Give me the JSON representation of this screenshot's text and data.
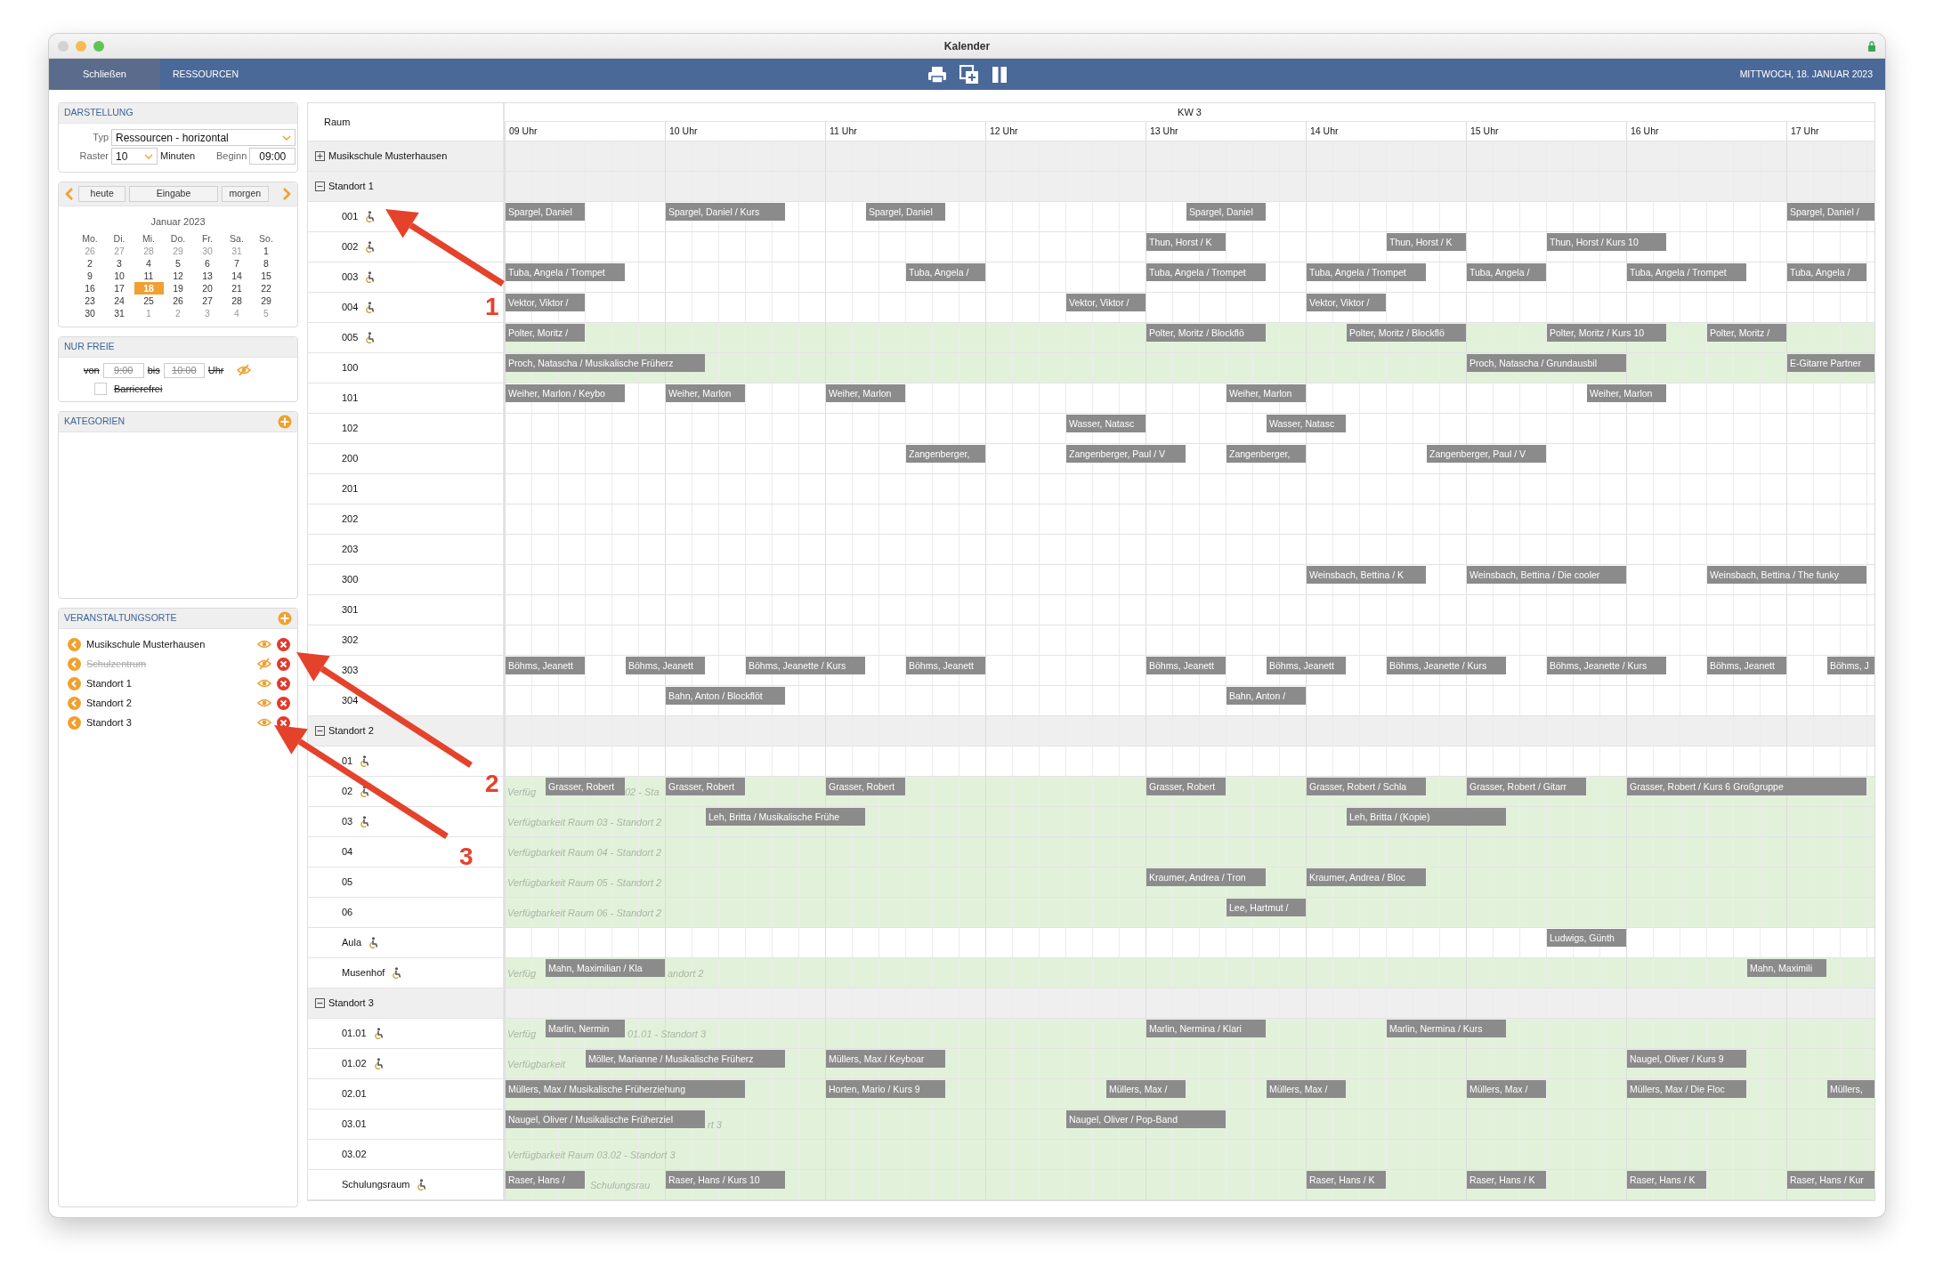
{
  "window": {
    "title": "Kalender"
  },
  "toolbar": {
    "close_button": "Schließen",
    "section": "RESSOURCEN",
    "date": "MITTWOCH, 18. JANUAR 2023"
  },
  "display": {
    "title": "DARSTELLUNG",
    "type_label": "Typ",
    "type_value": "Ressourcen - horizontal",
    "grid_label": "Raster",
    "grid_value": "10",
    "grid_unit": "Minuten",
    "start_label": "Beginn",
    "start_value": "09:00"
  },
  "date_nav": {
    "today": "heute",
    "entry": "Eingabe",
    "tomorrow": "morgen",
    "month": "Januar 2023",
    "weekdays": [
      "Mo.",
      "Di.",
      "Mi.",
      "Do.",
      "Fr.",
      "Sa.",
      "So."
    ],
    "weeks": [
      [
        {
          "day": "26",
          "other_month": true,
          "selected": false
        },
        {
          "day": "27",
          "other_month": true,
          "selected": false
        },
        {
          "day": "28",
          "other_month": true,
          "selected": false
        },
        {
          "day": "29",
          "other_month": true,
          "selected": false
        },
        {
          "day": "30",
          "other_month": true,
          "selected": false
        },
        {
          "day": "31",
          "other_month": true,
          "selected": false
        },
        {
          "day": "1",
          "other_month": false,
          "selected": false
        }
      ],
      [
        {
          "day": "2",
          "other_month": false,
          "selected": false
        },
        {
          "day": "3",
          "other_month": false,
          "selected": false
        },
        {
          "day": "4",
          "other_month": false,
          "selected": false
        },
        {
          "day": "5",
          "other_month": false,
          "selected": false
        },
        {
          "day": "6",
          "other_month": false,
          "selected": false
        },
        {
          "day": "7",
          "other_month": false,
          "selected": false
        },
        {
          "day": "8",
          "other_month": false,
          "selected": false
        }
      ],
      [
        {
          "day": "9",
          "other_month": false,
          "selected": false
        },
        {
          "day": "10",
          "other_month": false,
          "selected": false
        },
        {
          "day": "11",
          "other_month": false,
          "selected": false
        },
        {
          "day": "12",
          "other_month": false,
          "selected": false
        },
        {
          "day": "13",
          "other_month": false,
          "selected": false
        },
        {
          "day": "14",
          "other_month": false,
          "selected": false
        },
        {
          "day": "15",
          "other_month": false,
          "selected": false
        }
      ],
      [
        {
          "day": "16",
          "other_month": false,
          "selected": false
        },
        {
          "day": "17",
          "other_month": false,
          "selected": false
        },
        {
          "day": "18",
          "other_month": false,
          "selected": true
        },
        {
          "day": "19",
          "other_month": false,
          "selected": false
        },
        {
          "day": "20",
          "other_month": false,
          "selected": false
        },
        {
          "day": "21",
          "other_month": false,
          "selected": false
        },
        {
          "day": "22",
          "other_month": false,
          "selected": false
        }
      ],
      [
        {
          "day": "23",
          "other_month": false,
          "selected": false
        },
        {
          "day": "24",
          "other_month": false,
          "selected": false
        },
        {
          "day": "25",
          "other_month": false,
          "selected": false
        },
        {
          "day": "26",
          "other_month": false,
          "selected": false
        },
        {
          "day": "27",
          "other_month": false,
          "selected": false
        },
        {
          "day": "28",
          "other_month": false,
          "selected": false
        },
        {
          "day": "29",
          "other_month": false,
          "selected": false
        }
      ],
      [
        {
          "day": "30",
          "other_month": false,
          "selected": false
        },
        {
          "day": "31",
          "other_month": false,
          "selected": false
        },
        {
          "day": "1",
          "other_month": true,
          "selected": false
        },
        {
          "day": "2",
          "other_month": true,
          "selected": false
        },
        {
          "day": "3",
          "other_month": true,
          "selected": false
        },
        {
          "day": "4",
          "other_month": true,
          "selected": false
        },
        {
          "day": "5",
          "other_month": true,
          "selected": false
        }
      ]
    ]
  },
  "free_only": {
    "title": "NUR FREIE",
    "from_label": "von",
    "from_value": "9:00",
    "to_label": "bis",
    "to_value": "10:00",
    "unit": "Uhr",
    "enabled": false,
    "barrier_free": {
      "label": "Barrierefrei",
      "checked": false
    }
  },
  "categories": {
    "title": "KATEGORIEN"
  },
  "venues": {
    "title": "VERANSTALTUNGSORTE",
    "items": [
      {
        "name": "Musikschule Musterhausen",
        "visible": true
      },
      {
        "name": "Schulzentrum",
        "visible": false
      },
      {
        "name": "Standort 1",
        "visible": true
      },
      {
        "name": "Standort 2",
        "visible": true
      },
      {
        "name": "Standort 3",
        "visible": true
      }
    ]
  },
  "schedule": {
    "room_header": "Raum",
    "week": "KW 3",
    "hours": [
      "09 Uhr",
      "10 Uhr",
      "11 Uhr",
      "12 Uhr",
      "13 Uhr",
      "14 Uhr",
      "15 Uhr",
      "16 Uhr",
      "17 Uhr"
    ],
    "groups": [
      {
        "name": "Musikschule Musterhausen",
        "expanded": false
      },
      {
        "name": "Standort 1",
        "expanded": true,
        "rooms": [
          {
            "name": "001",
            "accessible": true,
            "available": false,
            "events": [
              {
                "text": "Spargel, Daniel"
              },
              {
                "text": "Spargel, Daniel / Kurs"
              },
              {
                "text": "Spargel, Daniel"
              },
              {
                "text": "Spargel, Daniel"
              },
              {
                "text": "Spargel, Daniel /"
              }
            ]
          },
          {
            "name": "002",
            "accessible": true,
            "available": false,
            "events": [
              {
                "text": "Thun, Horst / K"
              },
              {
                "text": "Thun, Horst / K"
              },
              {
                "text": "Thun, Horst / Kurs 10"
              }
            ]
          },
          {
            "name": "003",
            "accessible": true,
            "available": false,
            "events": [
              {
                "text": "Tuba, Angela / Trompet"
              },
              {
                "text": "Tuba, Angela /"
              },
              {
                "text": "Tuba, Angela / Trompet"
              },
              {
                "text": "Tuba, Angela / Trompet"
              },
              {
                "text": "Tuba, Angela /"
              },
              {
                "text": "Tuba, Angela / Trompet"
              },
              {
                "text": "Tuba, Angela /"
              }
            ]
          },
          {
            "name": "004",
            "accessible": true,
            "available": false,
            "events": [
              {
                "text": "Vektor, Viktor /"
              },
              {
                "text": "Vektor, Viktor /"
              },
              {
                "text": "Vektor, Viktor /"
              }
            ]
          },
          {
            "name": "005",
            "accessible": true,
            "available": true,
            "events": [
              {
                "text": "Polter, Moritz /"
              },
              {
                "text": "Polter, Moritz / Blockflö"
              },
              {
                "text": "Polter, Moritz / Blockflö"
              },
              {
                "text": "Polter, Moritz / Kurs 10"
              },
              {
                "text": "Polter, Moritz /"
              }
            ]
          },
          {
            "name": "100",
            "accessible": false,
            "available": true,
            "events": [
              {
                "text": "Proch, Natascha / Musikalische Früherz"
              },
              {
                "text": "Proch, Natascha / Grundausbil"
              },
              {
                "text": "E-Gitarre Partner"
              }
            ]
          },
          {
            "name": "101",
            "accessible": false,
            "available": false,
            "events": [
              {
                "text": "Weiher, Marlon / Keybo"
              },
              {
                "text": "Weiher, Marlon"
              },
              {
                "text": "Weiher, Marlon"
              },
              {
                "text": "Weiher, Marlon"
              },
              {
                "text": "Weiher, Marlon"
              }
            ]
          },
          {
            "name": "102",
            "accessible": false,
            "available": false,
            "events": [
              {
                "text": "Wasser, Natasc"
              },
              {
                "text": "Wasser, Natasc"
              }
            ]
          },
          {
            "name": "200",
            "accessible": false,
            "available": false,
            "events": [
              {
                "text": "Zangenberger,"
              },
              {
                "text": "Zangenberger, Paul / V"
              },
              {
                "text": "Zangenberger,"
              },
              {
                "text": "Zangenberger, Paul / V"
              }
            ]
          },
          {
            "name": "201",
            "accessible": false,
            "available": false
          },
          {
            "name": "202",
            "accessible": false,
            "available": false
          },
          {
            "name": "203",
            "accessible": false,
            "available": false
          },
          {
            "name": "300",
            "accessible": false,
            "available": false,
            "events": [
              {
                "text": "Weinsbach, Bettina / K"
              },
              {
                "text": "Weinsbach, Bettina / Die cooler"
              },
              {
                "text": "Weinsbach, Bettina / The funky"
              }
            ]
          },
          {
            "name": "301",
            "accessible": false,
            "available": false
          },
          {
            "name": "302",
            "accessible": false,
            "available": false
          },
          {
            "name": "303",
            "accessible": false,
            "available": false,
            "events": [
              {
                "text": "Böhms, Jeanett"
              },
              {
                "text": "Böhms, Jeanett"
              },
              {
                "text": "Böhms, Jeanette / Kurs"
              },
              {
                "text": "Böhms, Jeanett"
              },
              {
                "text": "Böhms, Jeanett"
              },
              {
                "text": "Böhms, Jeanett"
              },
              {
                "text": "Böhms, Jeanette / Kurs"
              },
              {
                "text": "Böhms, Jeanette / Kurs"
              },
              {
                "text": "Böhms, Jeanett"
              },
              {
                "text": "Böhms, J"
              }
            ]
          },
          {
            "name": "304",
            "accessible": false,
            "available": false,
            "events": [
              {
                "text": "Bahn, Anton / Blockflöt"
              },
              {
                "text": "Bahn, Anton /"
              }
            ]
          }
        ]
      },
      {
        "name": "Standort 2",
        "expanded": true,
        "rooms": [
          {
            "name": "01",
            "accessible": true,
            "available": false
          },
          {
            "name": "02",
            "accessible": true,
            "available": true,
            "availability": [
              {
                "text": "Verfüg"
              },
              {
                "text": "02 - Sta"
              }
            ],
            "events": [
              {
                "text": "Grasser, Robert"
              },
              {
                "text": "Grasser, Robert"
              },
              {
                "text": "Grasser, Robert"
              },
              {
                "text": "Grasser, Robert"
              },
              {
                "text": "Grasser, Robert / Schla"
              },
              {
                "text": "Grasser, Robert / Gitarr"
              },
              {
                "text": "Grasser, Robert / Kurs 6 Großgruppe"
              }
            ]
          },
          {
            "name": "03",
            "accessible": true,
            "available": true,
            "availability": [
              {
                "text": "Verfügbarkeit Raum 03 - Standort 2"
              }
            ],
            "events": [
              {
                "text": "Leh, Britta / Musikalische Frühe"
              },
              {
                "text": "Leh, Britta / (Kopie)"
              }
            ]
          },
          {
            "name": "04",
            "accessible": false,
            "available": true,
            "availability": [
              {
                "text": "Verfügbarkeit Raum 04 - Standort 2"
              }
            ]
          },
          {
            "name": "05",
            "accessible": false,
            "available": true,
            "availability": [
              {
                "text": "Verfügbarkeit Raum 05 - Standort 2"
              }
            ],
            "events": [
              {
                "text": "Kraumer, Andrea / Tron"
              },
              {
                "text": "Kraumer, Andrea / Bloc"
              }
            ]
          },
          {
            "name": "06",
            "accessible": false,
            "available": true,
            "availability": [
              {
                "text": "Verfügbarkeit Raum 06 - Standort 2"
              }
            ],
            "events": [
              {
                "text": "Lee, Hartmut /"
              }
            ]
          },
          {
            "name": "Aula",
            "accessible": true,
            "available": false,
            "events": [
              {
                "text": "Ludwigs, Günth"
              }
            ]
          },
          {
            "name": "Musenhof",
            "accessible": true,
            "available": true,
            "availability": [
              {
                "text": "Verfüg"
              },
              {
                "text": "andort 2"
              }
            ],
            "events": [
              {
                "text": "Mahn, Maximilian / Kla"
              },
              {
                "text": "Mahn, Maximili"
              }
            ]
          }
        ]
      },
      {
        "name": "Standort 3",
        "expanded": true,
        "rooms": [
          {
            "name": "01.01",
            "accessible": true,
            "available": true,
            "availability": [
              {
                "text": "Verfüg"
              },
              {
                "text": "01.01 - Standort 3"
              }
            ],
            "events": [
              {
                "text": "Marlin, Nermin"
              },
              {
                "text": "Marlin, Nermina / Klari"
              },
              {
                "text": "Marlin, Nermina / Kurs"
              }
            ]
          },
          {
            "name": "01.02",
            "accessible": true,
            "available": true,
            "availability": [
              {
                "text": "Verfügbarkeit"
              }
            ],
            "events": [
              {
                "text": "Möller, Marianne / Musikalische Früherz"
              },
              {
                "text": "Müllers, Max / Keyboar"
              },
              {
                "text": "Naugel, Oliver / Kurs 9"
              }
            ]
          },
          {
            "name": "02.01",
            "accessible": false,
            "available": true,
            "events": [
              {
                "text": "Müllers, Max / Musikalische Früherziehung"
              },
              {
                "text": "Horten, Mario / Kurs 9"
              },
              {
                "text": "Müllers, Max /"
              },
              {
                "text": "Müllers, Max /"
              },
              {
                "text": "Müllers, Max /"
              },
              {
                "text": "Müllers, Max / Die Floc"
              },
              {
                "text": "Müllers,"
              }
            ]
          },
          {
            "name": "03.01",
            "accessible": false,
            "available": true,
            "availability": [
              {
                "text": "rt 3"
              }
            ],
            "events": [
              {
                "text": "Naugel, Oliver / Musikalische Früherziel"
              },
              {
                "text": "Naugel, Oliver / Pop-Band"
              }
            ]
          },
          {
            "name": "03.02",
            "accessible": false,
            "available": true,
            "availability": [
              {
                "text": "Verfügbarkeit Raum 03.02 - Standort 3"
              }
            ]
          },
          {
            "name": "Schulungsraum",
            "accessible": true,
            "available": true,
            "availability": [
              {
                "text": "Schulungsrau"
              }
            ],
            "events": [
              {
                "text": "Raser, Hans /"
              },
              {
                "text": "Raser, Hans / Kurs 10"
              },
              {
                "text": "Raser, Hans / K"
              },
              {
                "text": "Raser, Hans / K"
              },
              {
                "text": "Raser, Hans / K"
              },
              {
                "text": "Raser, Hans / Kur"
              }
            ]
          }
        ]
      }
    ]
  },
  "annotations": [
    {
      "label": "1"
    },
    {
      "label": "2"
    },
    {
      "label": "3"
    }
  ]
}
